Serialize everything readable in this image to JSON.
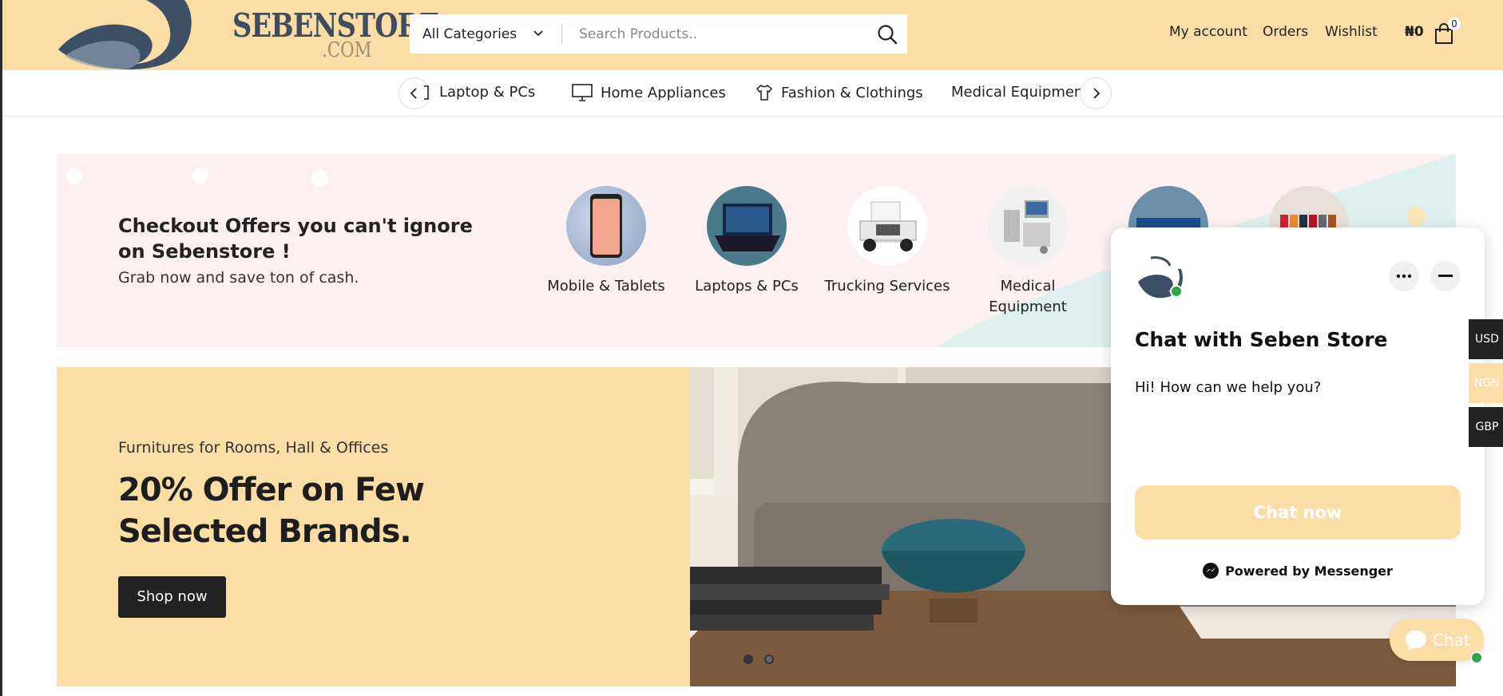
{
  "header": {
    "logo": {
      "name": "SEBENSTORE",
      "suffix": ".COM"
    },
    "category_select": {
      "value": "All Categories"
    },
    "search": {
      "placeholder": "Search Products.."
    },
    "links": [
      "My account",
      "Orders",
      "Wishlist"
    ],
    "cart_total": "₦0",
    "cart_count": "0"
  },
  "category_nav": {
    "items": [
      "Laptop & PCs",
      "Home Appliances",
      "Fashion & Clothings",
      "Medical Equipments"
    ]
  },
  "offers": {
    "title": "Checkout Offers you can't ignore on Sebenstore !",
    "subtitle": "Grab now and save ton of cash.",
    "categories": [
      {
        "label": "Mobile & Tablets",
        "icon": "smartphone-image"
      },
      {
        "label": "Laptops & PCs",
        "icon": "laptop-image"
      },
      {
        "label": "Trucking Services",
        "icon": "truck-image"
      },
      {
        "label": "Medical Equipment",
        "icon": "medical-equipment-image"
      },
      {
        "label": "",
        "icon": "tv-image"
      },
      {
        "label": "",
        "icon": "clothing-rack-image"
      }
    ]
  },
  "hero": {
    "eyebrow": "Furnitures for Rooms, Hall & Offices",
    "title": "20% Offer on Few Selected Brands.",
    "button": "Shop now",
    "slides": 2,
    "active_slide": 1
  },
  "chat": {
    "title": "Chat with Seben Store",
    "message": "Hi! How can we help you?",
    "button": "Chat now",
    "powered_by": "Powered by Messenger",
    "fab_label": "Chat"
  },
  "currencies": [
    {
      "code": "USD",
      "active": false
    },
    {
      "code": "NGN",
      "active": true
    },
    {
      "code": "GBP",
      "active": false
    }
  ],
  "colors": {
    "accent": "#fbdda6",
    "dark": "#222222",
    "pink_band": "#fdf0f0",
    "online": "#31a24c"
  }
}
